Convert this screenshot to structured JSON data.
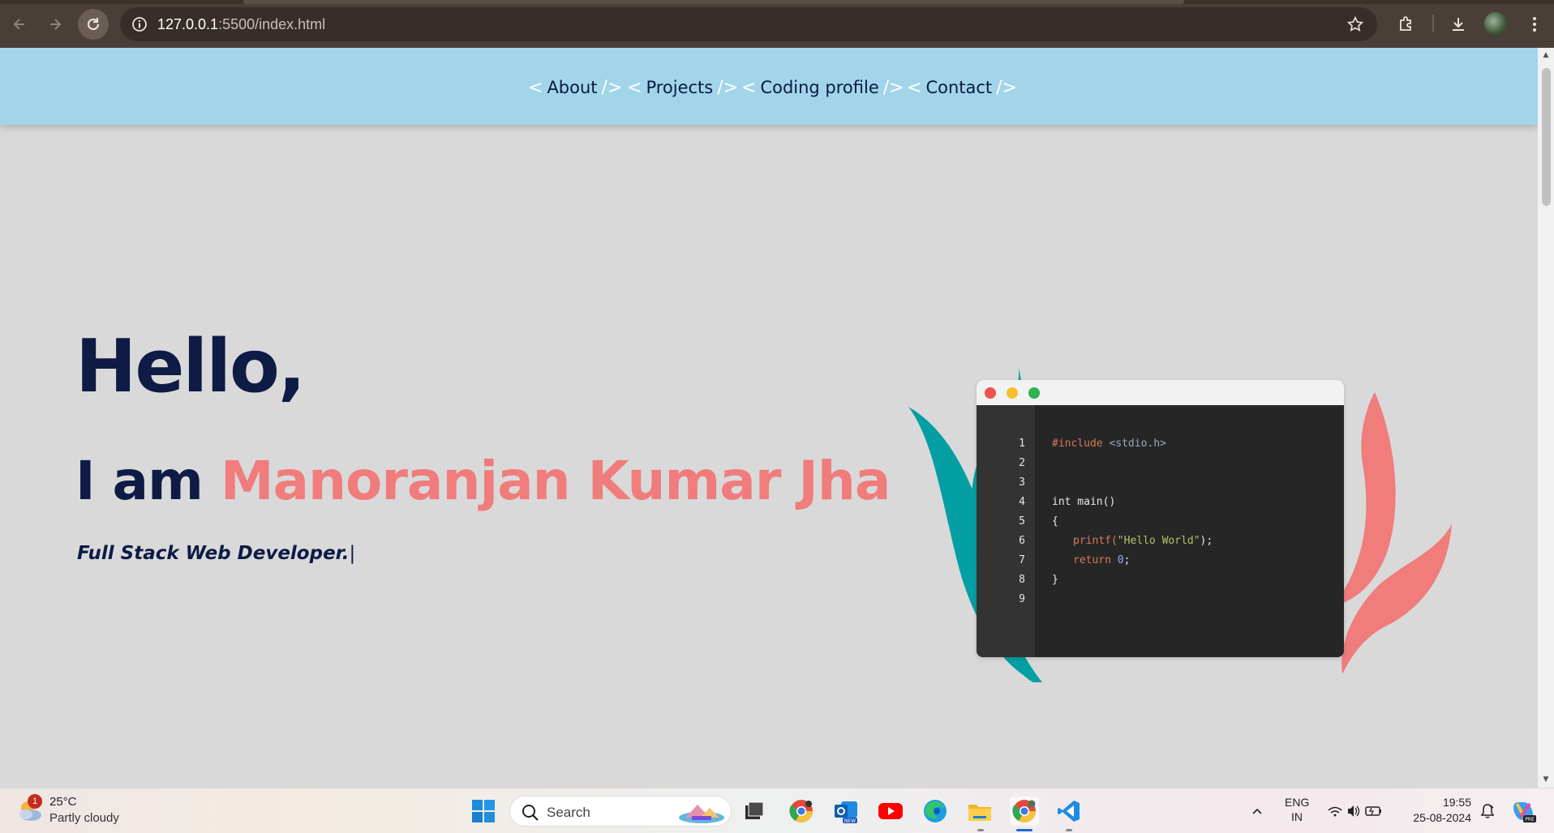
{
  "browser": {
    "url_host": "127.0.0.1",
    "url_rest": ":5500/index.html"
  },
  "nav": {
    "items": [
      {
        "open": "<",
        "label": "About",
        "close": "/>"
      },
      {
        "open": "<",
        "label": "Projects",
        "close": "/>"
      },
      {
        "open": "<",
        "label": "Coding profile",
        "close": "/>"
      },
      {
        "open": "<",
        "label": "Contact",
        "close": "/>"
      }
    ]
  },
  "hero": {
    "greeting": "Hello,",
    "intro_prefix": "I am ",
    "name": "Manoranjan Kumar Jha",
    "role": "Full Stack Web Developer.",
    "cursor": "|"
  },
  "code_window": {
    "line_numbers": [
      "1",
      "2",
      "3",
      "4",
      "5",
      "6",
      "7",
      "8",
      "9"
    ],
    "include_directive": "#include",
    "include_header": "<stdio.h>",
    "main_sig": "int main()",
    "open_brace": "{",
    "printf_fn": "printf(",
    "printf_arg": "\"Hello World\"",
    "printf_end": ");",
    "return_kw": "return",
    "return_val": "0",
    "return_end": ";",
    "close_brace": "}",
    "dot_colors": [
      "#f0524f",
      "#f5c12e",
      "#2fb24f"
    ]
  },
  "colors": {
    "header_bg": "#a2d5ea",
    "navy": "#0d1b45",
    "accent_coral": "#f07c7c",
    "leaf_teal": "#049fa3",
    "leaf_coral": "#f07c7c",
    "page_bg": "#d9d9d9"
  },
  "taskbar": {
    "weather_badge": "1",
    "temperature": "25°C",
    "condition": "Partly cloudy",
    "search_placeholder": "Search",
    "lang_top": "ENG",
    "lang_bottom": "IN",
    "time": "19:55",
    "date": "25-08-2024",
    "apps": [
      "windows-start",
      "search",
      "task-view",
      "chrome-profile",
      "outlook-new",
      "youtube",
      "edge",
      "file-explorer",
      "chrome",
      "vscode"
    ]
  }
}
